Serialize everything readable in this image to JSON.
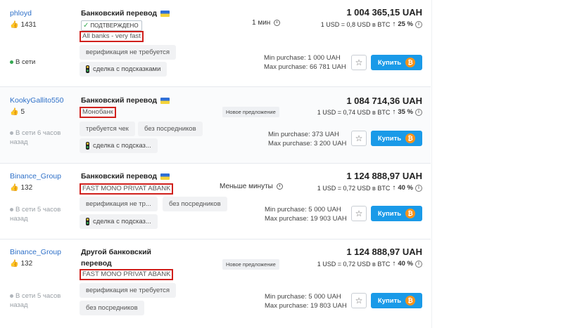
{
  "offers": [
    {
      "user": "phloyd",
      "likes": "1431",
      "status": "В сети",
      "method": "Банковский перевод",
      "verified": "ПОДТВЕРЖДЕНО",
      "highlight": "All banks - very fast",
      "tags": [
        "верификация не требуется"
      ],
      "hint": "сделка с подсказками",
      "time": "1 мин",
      "badge": "",
      "price": "1 004 365,15 UAH",
      "rate": "1 USD = 0,8 USD в BTC",
      "margin": "25 %",
      "min": "Min purchase: 1 000 UAH",
      "max": "Max purchase: 66 781 UAH",
      "buy": "Купить"
    },
    {
      "user": "KookyGallito550",
      "likes": "5",
      "status": "В сети 6 часов назад",
      "method": "Банковский перевод",
      "highlight": "Монобанк",
      "tags": [
        "требуется чек",
        "без посредников"
      ],
      "hint": "сделка с подсказ...",
      "badge": "Новое предложение",
      "price": "1 084 714,36 UAH",
      "rate": "1 USD = 0,74 USD в BTC",
      "margin": "35 %",
      "min": "Min purchase: 373 UAH",
      "max": "Max purchase: 3 200 UAH",
      "buy": "Купить"
    },
    {
      "user": "Binance_Group",
      "likes": "132",
      "status": "В сети 5 часов назад",
      "method": "Банковский перевод",
      "highlight": "FAST MONO PRIVAT ABANK",
      "tags": [
        "верификация не тр...",
        "без посредников"
      ],
      "hint": "сделка с подсказ...",
      "time": "Меньше минуты",
      "price": "1 124 888,97 UAH",
      "rate": "1 USD = 0,72 USD в BTC",
      "margin": "40 %",
      "min": "Min purchase: 5 000 UAH",
      "max": "Max purchase: 19 903 UAH",
      "buy": "Купить"
    },
    {
      "user": "Binance_Group",
      "likes": "132",
      "status": "В сети 5 часов назад",
      "method_line1": "Другой банковский",
      "method_line2": "перевод",
      "highlight": "FAST MONO PRIVAT ABANK",
      "tags": [
        "верификация не требуется",
        "без посредников"
      ],
      "badge": "Новое предложение",
      "price": "1 124 888,97 UAH",
      "rate": "1 USD = 0,72 USD в BTC",
      "margin": "40 %",
      "min": "Min purchase: 5 000 UAH",
      "max": "Max purchase: 19 803 UAH",
      "buy": "Купить"
    }
  ],
  "colors": {
    "accent": "#1a9ae8",
    "highlight_border": "#d0201c",
    "username": "#2e70c8",
    "bitcoin": "#f7931a"
  },
  "icons": [
    "thumbs-up-icon",
    "ukraine-flag-icon",
    "check-icon",
    "traffic-light-icon",
    "clock-icon",
    "arrow-up-icon",
    "info-icon",
    "star-icon",
    "bitcoin-icon"
  ]
}
